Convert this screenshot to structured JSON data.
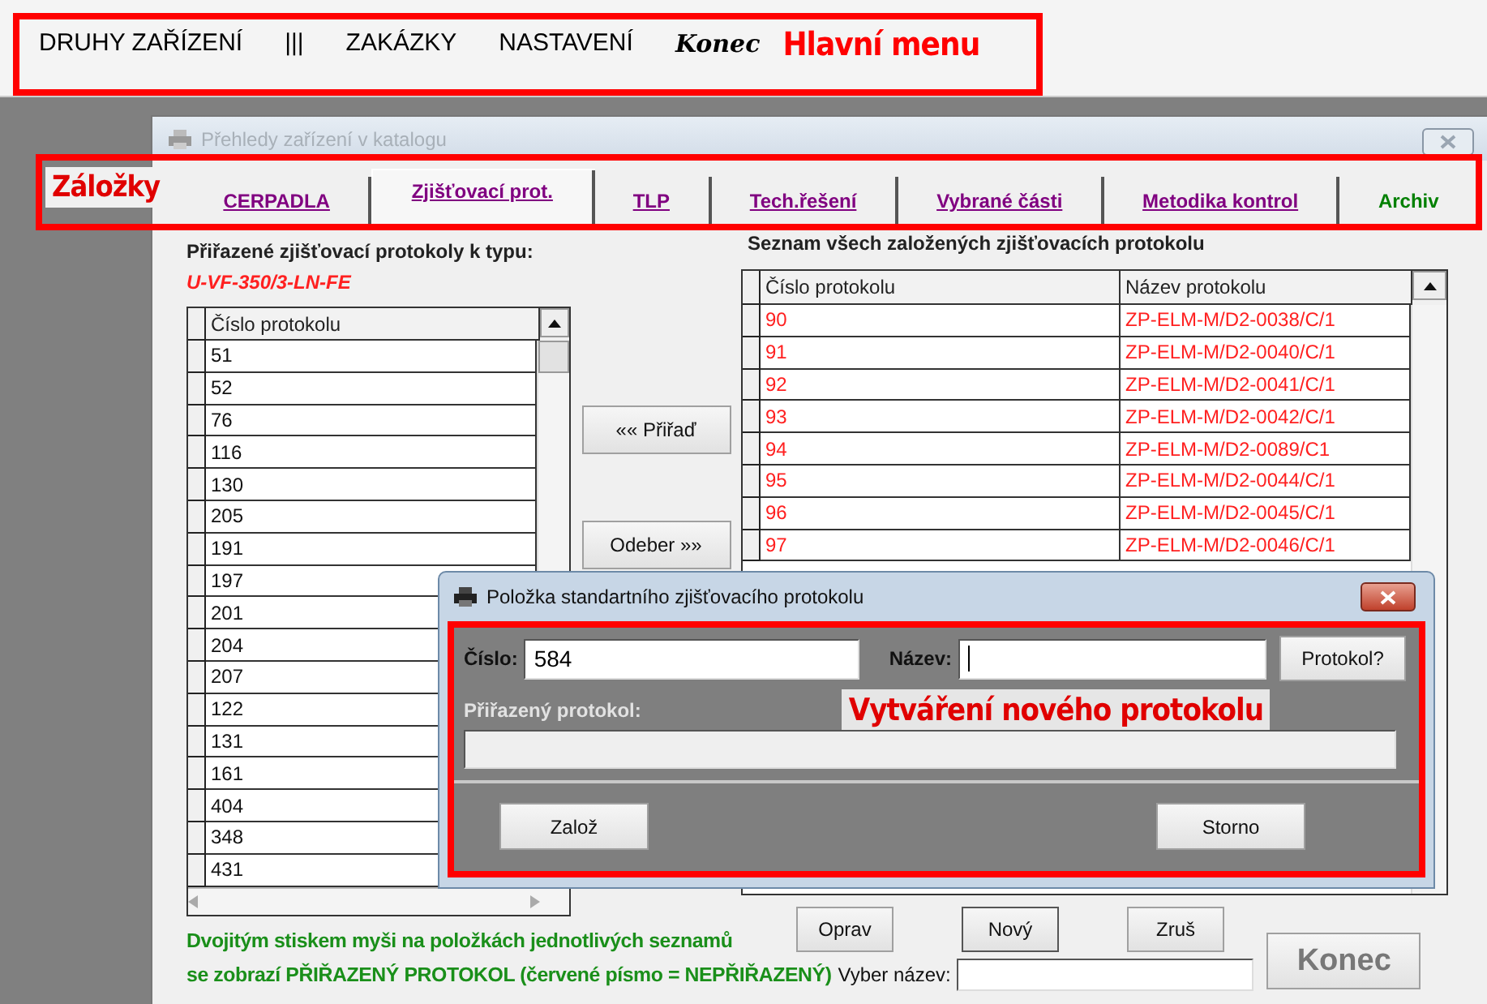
{
  "main_menu": {
    "items": [
      {
        "label": "DRUHY ZAŘÍZENÍ",
        "kind": "menu"
      },
      {
        "label": "|||",
        "kind": "menu"
      },
      {
        "label": "ZAKÁZKY",
        "kind": "menu"
      },
      {
        "label": "NASTAVENÍ",
        "kind": "menu"
      },
      {
        "label": "Konec",
        "kind": "exit"
      }
    ],
    "annotation": "Hlavní menu"
  },
  "window": {
    "title": "Přehledy zařízení v katalogu"
  },
  "tabs_annotation": "Záložky",
  "tabs": [
    {
      "label": "CERPADLA",
      "selected": false,
      "color": "#800080"
    },
    {
      "label": "Zjišťovací prot.",
      "selected": true,
      "color": "#800080"
    },
    {
      "label": "TLP",
      "selected": false,
      "color": "#800080"
    },
    {
      "label": "Tech.řešení",
      "selected": false,
      "color": "#800080"
    },
    {
      "label": "Vybrané části",
      "selected": false,
      "color": "#800080"
    },
    {
      "label": "Metodika kontrol",
      "selected": false,
      "color": "#800080"
    },
    {
      "label": "Archiv",
      "selected": false,
      "color": "#008000"
    }
  ],
  "assigned_panel": {
    "heading": "Přiřazené zjišťovací protokoly k typu:",
    "type_code": "U-VF-350/3-LN-FE",
    "columns": [
      "Číslo protokolu"
    ],
    "rows": [
      {
        "number": "51",
        "assigned": true
      },
      {
        "number": "52",
        "assigned": true
      },
      {
        "number": "76",
        "assigned": true
      },
      {
        "number": "116",
        "assigned": true
      },
      {
        "number": "130",
        "assigned": true
      },
      {
        "number": "205",
        "assigned": true
      },
      {
        "number": "191",
        "assigned": true
      },
      {
        "number": "197",
        "assigned": true
      },
      {
        "number": "201",
        "assigned": true
      },
      {
        "number": "204",
        "assigned": true
      },
      {
        "number": "207",
        "assigned": true
      },
      {
        "number": "122",
        "assigned": true
      },
      {
        "number": "131",
        "assigned": true
      },
      {
        "number": "161",
        "assigned": true
      },
      {
        "number": "404",
        "assigned": true
      },
      {
        "number": "348",
        "assigned": true
      },
      {
        "number": "431",
        "assigned": true
      }
    ]
  },
  "transfer_buttons": [
    "«« Přiřaď",
    "Odeber »»"
  ],
  "all_panel": {
    "heading": "Seznam všech založených zjišťovacích protokolu",
    "columns": [
      "Číslo protokolu",
      "Název protokolu"
    ],
    "rows": [
      {
        "number": "90",
        "name": "ZP-ELM-M/D2-0038/C/1",
        "assigned": false
      },
      {
        "number": "91",
        "name": "ZP-ELM-M/D2-0040/C/1",
        "assigned": false
      },
      {
        "number": "92",
        "name": "ZP-ELM-M/D2-0041/C/1",
        "assigned": false
      },
      {
        "number": "93",
        "name": "ZP-ELM-M/D2-0042/C/1",
        "assigned": false
      },
      {
        "number": "94",
        "name": "ZP-ELM-M/D2-0089/C1",
        "assigned": false
      },
      {
        "number": "95",
        "name": "ZP-ELM-M/D2-0044/C/1",
        "assigned": false
      },
      {
        "number": "96",
        "name": "ZP-ELM-M/D2-0045/C/1",
        "assigned": false
      },
      {
        "number": "97",
        "name": "ZP-ELM-M/D2-0046/C/1",
        "assigned": false
      }
    ]
  },
  "hint": [
    "Dvojitým stiskem myši na položkách jednotlivých seznamů",
    "se zobrazí PŘIŘAZENÝ PROTOKOL (červené písmo = NEPŘIŘAZENÝ)"
  ],
  "actions": [
    "Oprav",
    "Nový",
    "Zruš"
  ],
  "search": {
    "label": "Vyber název:"
  },
  "close_button": "Konec",
  "dialog": {
    "title": "Položka standartního zjišťovacího protokolu",
    "number_label": "Číslo:",
    "number_value": "584",
    "name_label": "Název:",
    "lookup_button": "Protokol?",
    "assigned_label": "Přiřazený protokol:",
    "annotation": "Vytváření nového protokolu",
    "buttons": [
      "Založ",
      "Storno"
    ]
  }
}
